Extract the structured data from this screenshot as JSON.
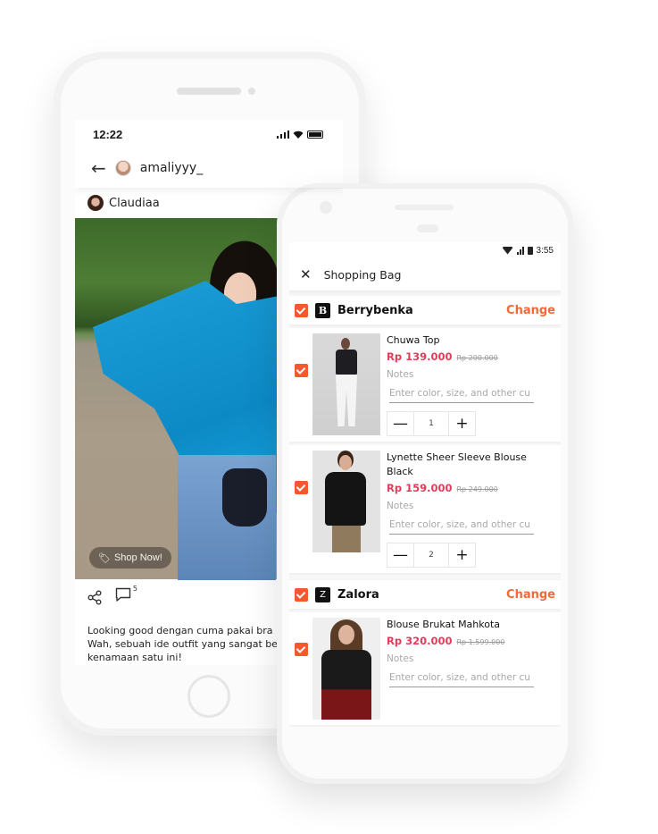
{
  "social_phone": {
    "status_bar": {
      "time": "12:22"
    },
    "header": {
      "username": "amaliyyy_"
    },
    "post": {
      "author": "Claudiaa",
      "shop_button": "Shop Now!",
      "comment_count": "5",
      "caption_lines": [
        "Looking good dengan cuma pakai bra",
        "Wah, sebuah ide outfit yang sangat be",
        "kenamaan satu ini!"
      ]
    }
  },
  "shopping_phone": {
    "status_bar": {
      "time": "3:55"
    },
    "app_bar": {
      "title": "Shopping Bag"
    },
    "accent_color": "#f4592e",
    "price_color": "#e23c5a",
    "stores": [
      {
        "name": "Berrybenka",
        "logo_letter": "B",
        "change_label": "Change",
        "checked": true,
        "items": [
          {
            "name": "Chuwa Top",
            "price": "Rp 139.000",
            "original_price": "Rp 200.000",
            "notes_label": "Notes",
            "notes_placeholder": "Enter color, size, and other cu",
            "quantity": "1",
            "checked": true
          },
          {
            "name": "Lynette Sheer Sleeve Blouse Black",
            "price": "Rp 159.000",
            "original_price": "Rp 249.000",
            "notes_label": "Notes",
            "notes_placeholder": "Enter color, size, and other cu",
            "quantity": "2",
            "checked": true
          }
        ]
      },
      {
        "name": "Zalora",
        "logo_letter": "Z",
        "change_label": "Change",
        "checked": true,
        "items": [
          {
            "name": "Blouse Brukat Mahkota",
            "price": "Rp 320.000",
            "original_price": "Rp 1.599.000",
            "notes_label": "Notes",
            "notes_placeholder": "Enter color, size, and other cu",
            "checked": true
          }
        ]
      }
    ]
  }
}
